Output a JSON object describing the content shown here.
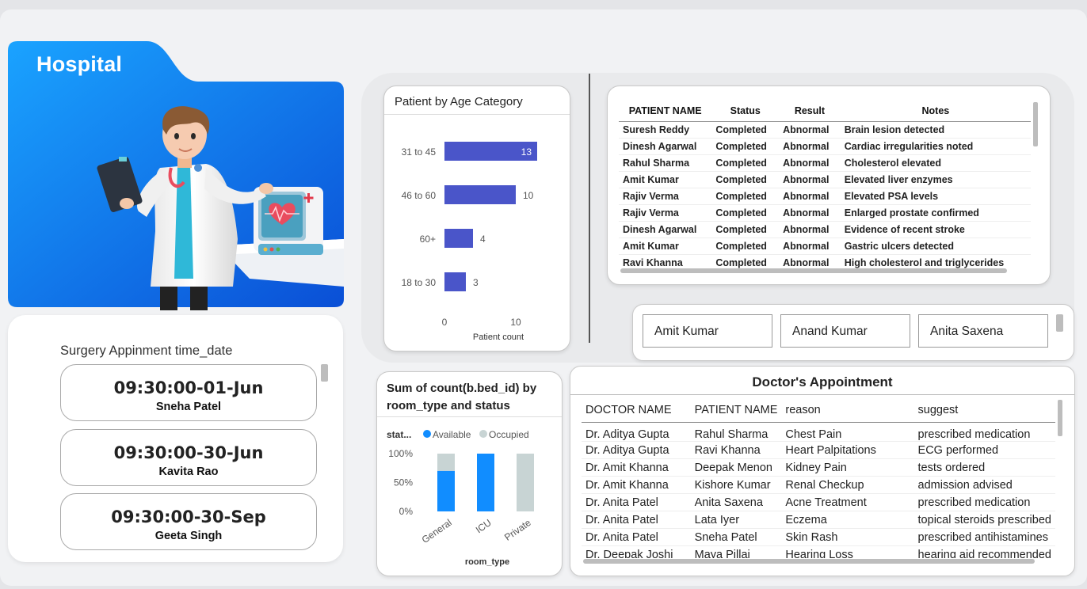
{
  "app": {
    "title": "Hospital"
  },
  "surgery": {
    "title": "Surgery Appinment time_date",
    "cards": [
      {
        "time": "09:30:00-01-Jun",
        "name": "Sneha Patel"
      },
      {
        "time": "09:30:00-30-Jun",
        "name": "Kavita Rao"
      },
      {
        "time": "09:30:00-30-Sep",
        "name": "Geeta Singh"
      }
    ]
  },
  "age_chart": {
    "title": "Patient by Age Category",
    "xlabel": "Patient count",
    "bar_color": "#4a55c9",
    "x_ticks": [
      "0",
      "10"
    ],
    "categories": [
      "31 to 45",
      "46 to 60",
      "60+",
      "18 to 30"
    ],
    "values": [
      13,
      10,
      4,
      3
    ],
    "labels": [
      "13",
      "10",
      "4",
      "3"
    ]
  },
  "patient_table": {
    "headers": [
      "PATIENT NAME",
      "Status",
      "Result",
      "Notes"
    ],
    "rows": [
      [
        "Suresh Reddy",
        "Completed",
        "Abnormal",
        "Brain lesion detected"
      ],
      [
        "Dinesh Agarwal",
        "Completed",
        "Abnormal",
        "Cardiac irregularities noted"
      ],
      [
        "Rahul Sharma",
        "Completed",
        "Abnormal",
        "Cholesterol elevated"
      ],
      [
        "Amit Kumar",
        "Completed",
        "Abnormal",
        "Elevated liver enzymes"
      ],
      [
        "Rajiv Verma",
        "Completed",
        "Abnormal",
        "Elevated PSA levels"
      ],
      [
        "Rajiv Verma",
        "Completed",
        "Abnormal",
        "Enlarged prostate confirmed"
      ],
      [
        "Dinesh Agarwal",
        "Completed",
        "Abnormal",
        "Evidence of recent stroke"
      ],
      [
        "Amit Kumar",
        "Completed",
        "Abnormal",
        "Gastric ulcers detected"
      ],
      [
        "Ravi Khanna",
        "Completed",
        "Abnormal",
        "High cholesterol and triglycerides"
      ]
    ]
  },
  "slicer": {
    "items": [
      "Amit Kumar",
      "Anand Kumar",
      "Anita Saxena"
    ]
  },
  "bed_chart": {
    "title_line1": "Sum of count(b.bed_id) by",
    "title_line2": "room_type and status",
    "legend_title": "stat...",
    "legend": [
      {
        "name": "Available",
        "color": "#118dff"
      },
      {
        "name": "Occupied",
        "color": "#c8d4d4"
      }
    ],
    "y_ticks": [
      "100%",
      "50%",
      "0%"
    ],
    "xlabel": "room_type",
    "categories": [
      "General",
      "ICU",
      "Private"
    ],
    "available_share": [
      0.7,
      1.0,
      0.0
    ]
  },
  "doctor_table": {
    "title": "Doctor's Appointment",
    "headers": [
      "DOCTOR NAME",
      "PATIENT NAME",
      "reason",
      "suggest"
    ],
    "rows": [
      [
        "Dr. Aditya Gupta",
        "Rahul Sharma",
        "Chest Pain",
        "prescribed medication"
      ],
      [
        "Dr. Aditya Gupta",
        "Ravi Khanna",
        "Heart Palpitations",
        "ECG performed"
      ],
      [
        "Dr. Amit Khanna",
        "Deepak Menon",
        "Kidney Pain",
        "tests ordered"
      ],
      [
        "Dr. Amit Khanna",
        "Kishore Kumar",
        "Renal Checkup",
        "admission advised"
      ],
      [
        "Dr. Anita Patel",
        "Anita Saxena",
        "Acne Treatment",
        "prescribed medication"
      ],
      [
        "Dr. Anita Patel",
        "Lata Iyer",
        "Eczema",
        "topical steroids prescribed"
      ],
      [
        "Dr. Anita Patel",
        "Sneha Patel",
        "Skin Rash",
        "prescribed antihistamines"
      ],
      [
        "Dr. Deepak Joshi",
        "Maya Pillai",
        "Hearing Loss",
        "hearing aid recommended"
      ]
    ]
  }
}
